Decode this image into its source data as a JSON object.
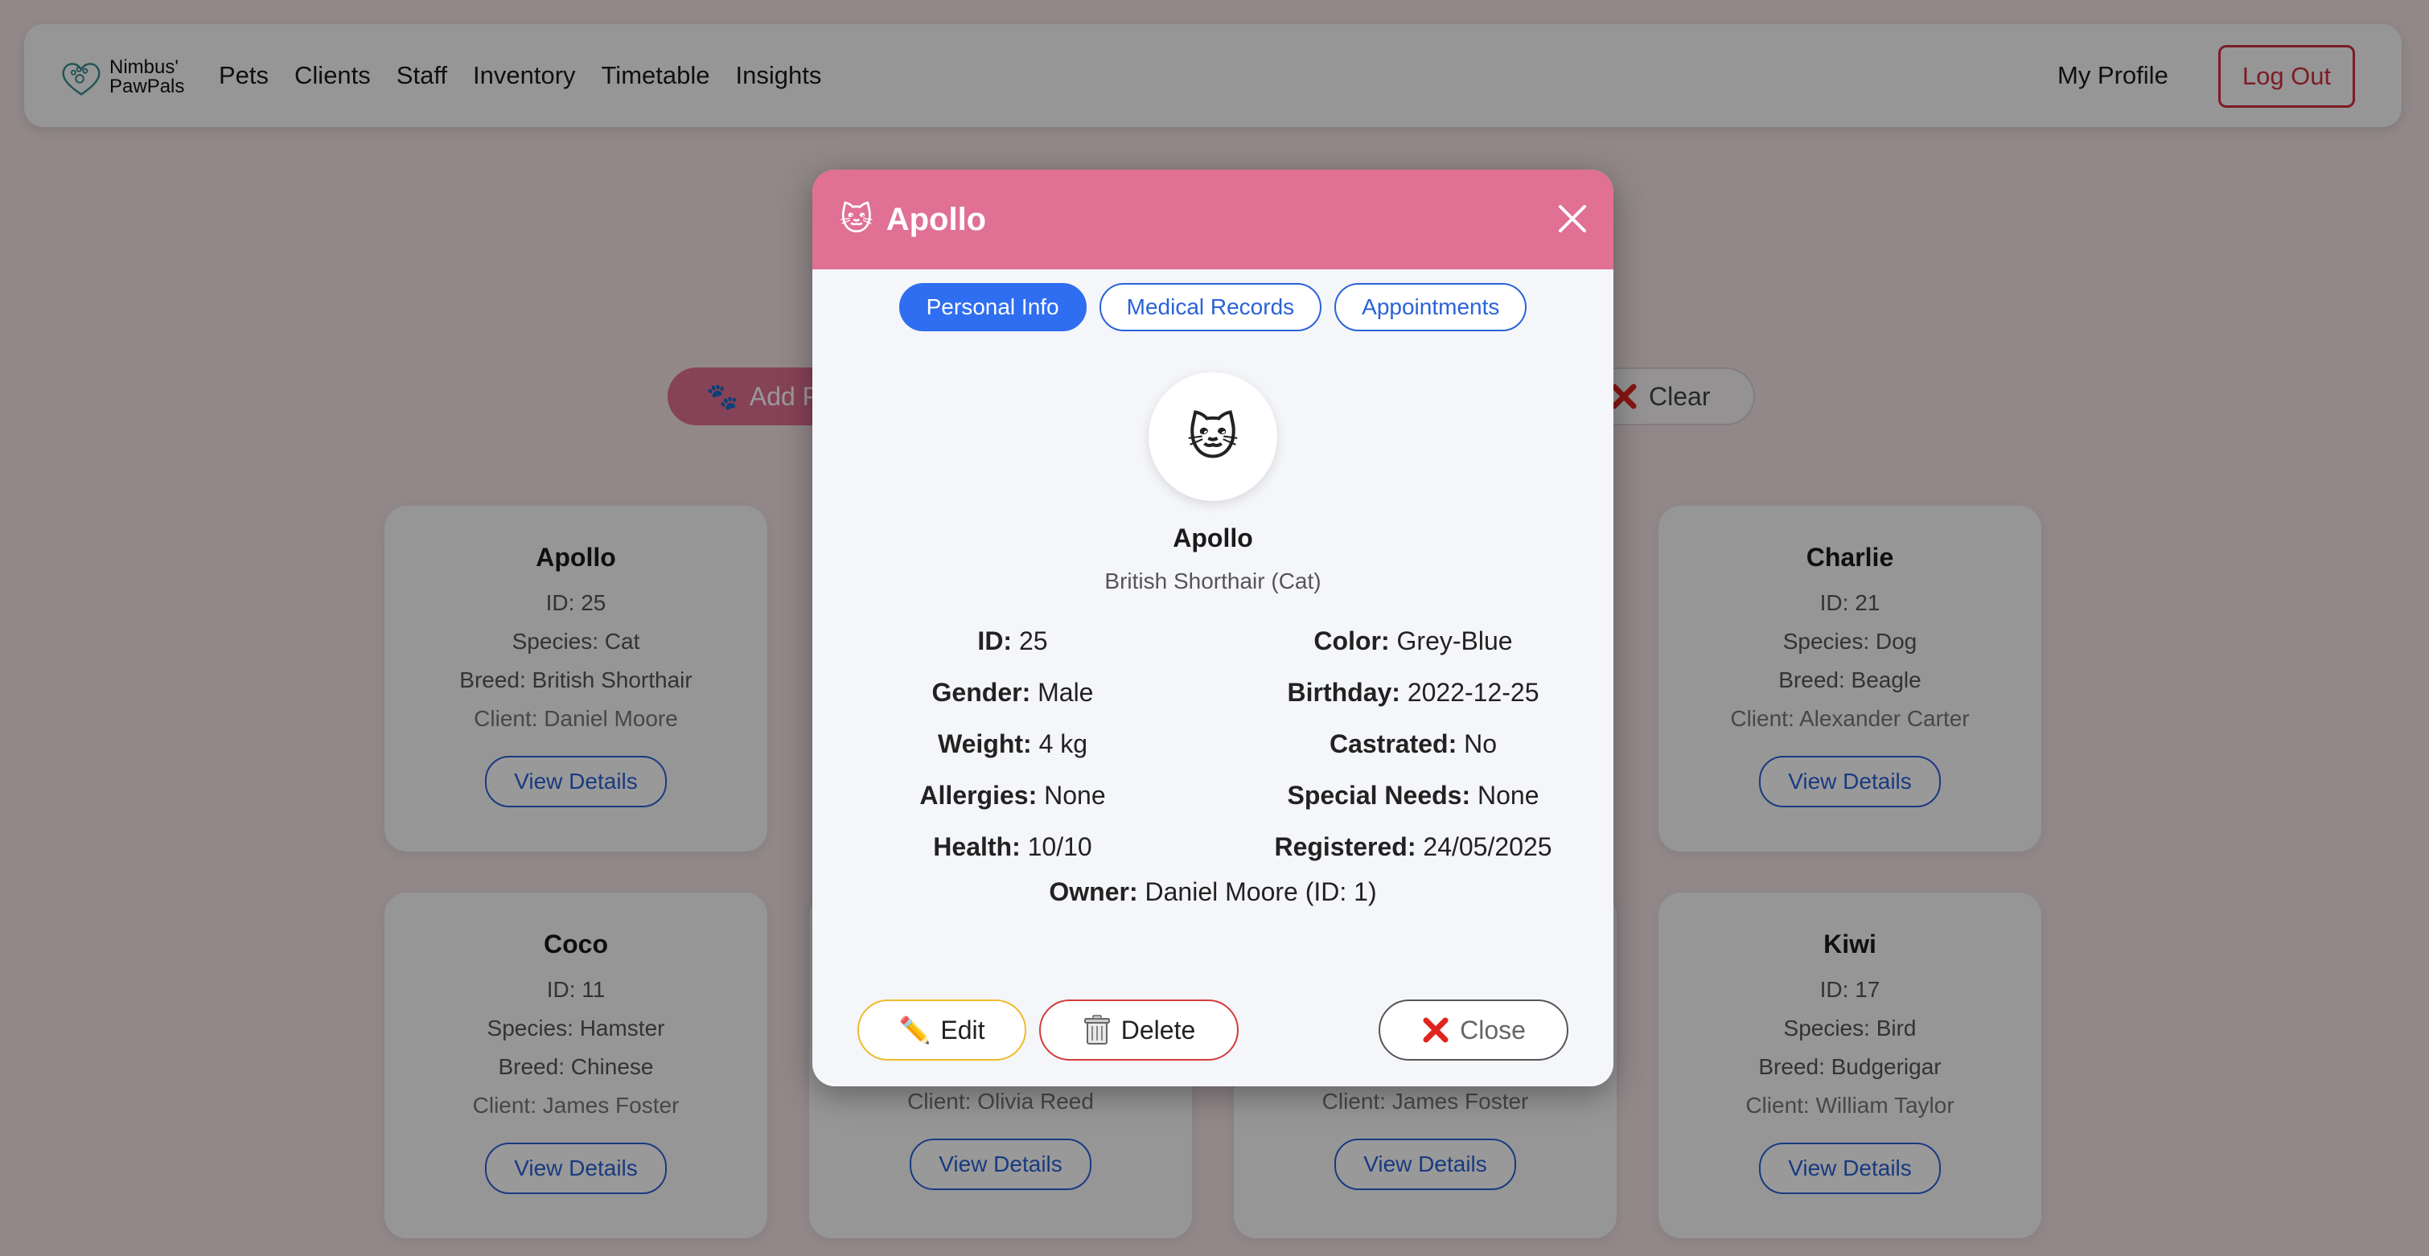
{
  "app": {
    "brand_line1": "Nimbus'",
    "brand_line2": "PawPals"
  },
  "nav": {
    "links": [
      "Pets",
      "Clients",
      "Staff",
      "Inventory",
      "Timetable",
      "Insights"
    ],
    "my_profile": "My Profile",
    "logout": "Log Out"
  },
  "toolbar": {
    "add_label": "Add Pet",
    "clear_label": "Clear"
  },
  "cards": [
    {
      "name": "Apollo",
      "id": "ID: 25",
      "species": "Species: Cat",
      "breed": "Breed: British Shorthair",
      "client": "Client: Daniel Moore",
      "button": "View Details"
    },
    {
      "name": "Charlie",
      "id": "ID: 21",
      "species": "Species: Dog",
      "breed": "Breed: Beagle",
      "client": "Client: Alexander Carter",
      "button": "View Details"
    },
    {
      "name": "Coco",
      "id": "ID: 11",
      "species": "Species: Hamster",
      "breed": "Breed: Chinese",
      "client": "Client: James Foster",
      "button": "View Details"
    },
    {
      "client": "Client: Olivia Reed",
      "button": "View Details"
    },
    {
      "client": "Client: James Foster",
      "button": "View Details"
    },
    {
      "name": "Kiwi",
      "id": "ID: 17",
      "species": "Species: Bird",
      "breed": "Breed: Budgerigar",
      "client": "Client: William Taylor",
      "button": "View Details"
    }
  ],
  "modal": {
    "title": "Apollo",
    "title_icon": "cat-face-icon",
    "tabs": [
      "Personal Info",
      "Medical Records",
      "Appointments"
    ],
    "active_tab": "Personal Info",
    "pet_name": "Apollo",
    "pet_breed": "British Shorthair (Cat)",
    "fields": {
      "id": {
        "label": "ID:",
        "value": "25"
      },
      "color": {
        "label": "Color:",
        "value": "Grey-Blue"
      },
      "gender": {
        "label": "Gender:",
        "value": "Male"
      },
      "birthday": {
        "label": "Birthday:",
        "value": "2022-12-25"
      },
      "weight": {
        "label": "Weight:",
        "value": "4 kg"
      },
      "castrated": {
        "label": "Castrated:",
        "value": "No"
      },
      "allergies": {
        "label": "Allergies:",
        "value": "None"
      },
      "special": {
        "label": "Special Needs:",
        "value": "None"
      },
      "health": {
        "label": "Health:",
        "value": "10/10"
      },
      "registered": {
        "label": "Registered:",
        "value": "24/05/2025"
      },
      "owner": {
        "label": "Owner:",
        "value": "Daniel Moore (ID: 1)"
      }
    },
    "buttons": {
      "edit": "Edit",
      "delete": "Delete",
      "close": "Close"
    }
  },
  "colors": {
    "accent_pink": "#e07094",
    "primary_blue": "#2f6ef0",
    "danger_red": "#d0303d",
    "edit_yellow": "#f0b92c"
  }
}
